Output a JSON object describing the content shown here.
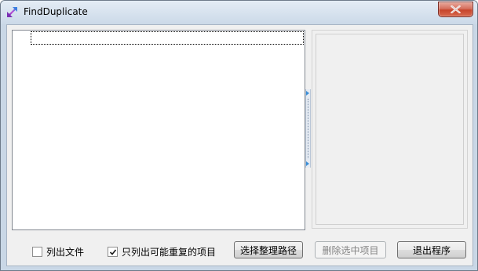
{
  "window": {
    "title": "FindDuplicate",
    "icon": "arrow-expand-icon",
    "close_icon": "close-icon"
  },
  "tree": {
    "items": []
  },
  "options": {
    "list_files": {
      "label": "列出文件",
      "checked": false
    },
    "list_duplicates_only": {
      "label": "只列出可能重复的项目",
      "checked": true
    }
  },
  "buttons": {
    "select_path": "选择整理路径",
    "delete_selected": "删除选中项目",
    "exit": "退出程序"
  },
  "colors": {
    "accent": "#3b8fd8",
    "close_red": "#c7442b"
  }
}
